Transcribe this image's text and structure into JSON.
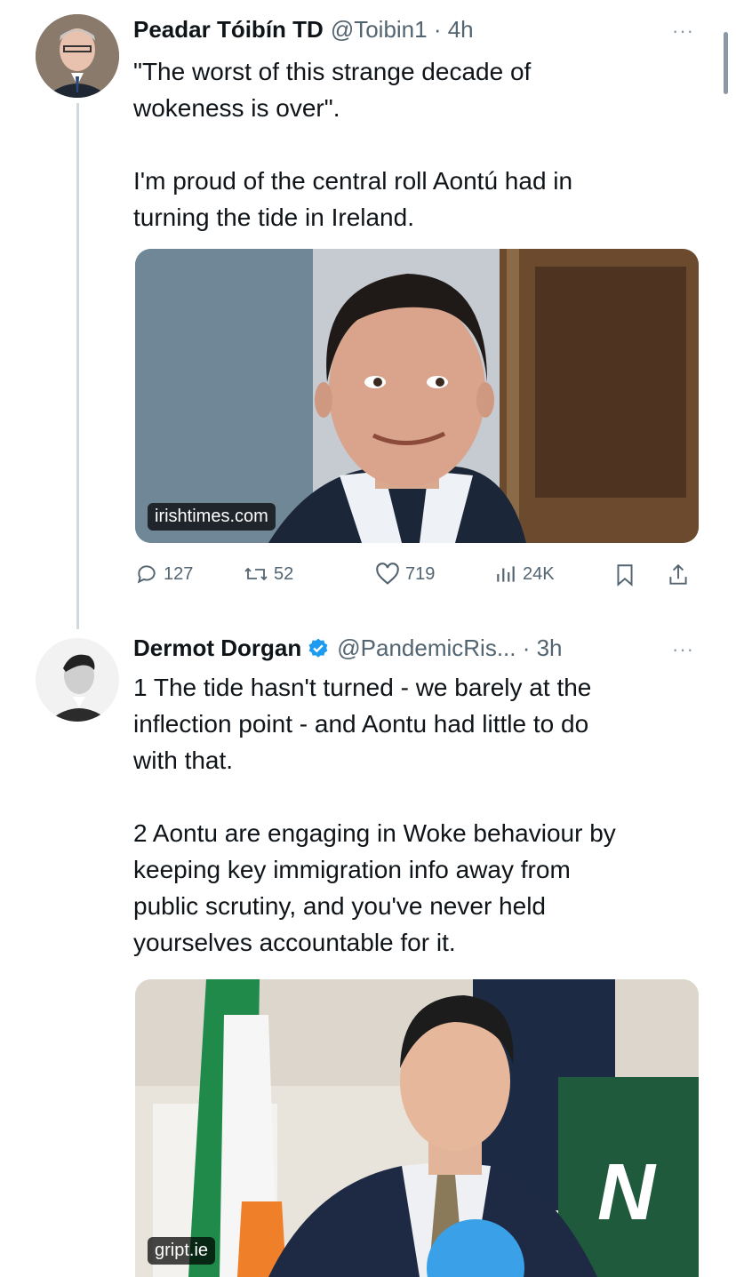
{
  "tweets": [
    {
      "author_name": "Peadar Tóibín TD",
      "handle_time": "@Toibin1 · 4h",
      "text_lines": [
        "\"The worst of this strange decade of",
        "wokeness is over\"."
      ],
      "text_lines2": [
        "I'm proud of the central roll Aontú had in",
        "turning the tide in Ireland."
      ],
      "media_domain": "irishtimes.com",
      "replies": "127",
      "reposts": "52",
      "likes": "719",
      "views": "24K"
    },
    {
      "author_name": "Dermot Dorgan",
      "handle_time": "@PandemicRis... · 3h",
      "verified": true,
      "para1": [
        "1 The tide hasn't turned - we barely at the",
        "inflection point - and Aontu had little to do",
        "with that."
      ],
      "para2": [
        "2 Aontu are engaging in Woke behaviour by",
        "keeping key immigration info away from",
        "public scrutiny, and you've never held",
        "yourselves accountable for it."
      ],
      "media_domain": "gript.ie"
    }
  ],
  "more_glyph": "···",
  "colors": {
    "text": "#0f1419",
    "muted": "#536471",
    "verified": "#1d9bf0",
    "thread": "#cfd9de"
  }
}
